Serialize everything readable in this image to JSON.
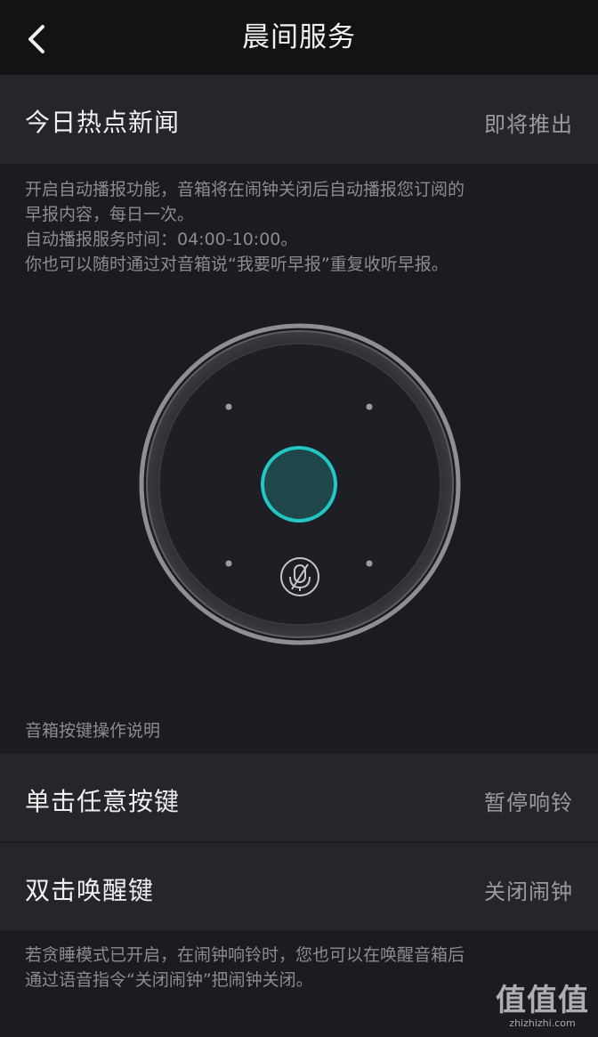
{
  "nav": {
    "title": "晨间服务",
    "back_icon": "chevron-left-icon"
  },
  "news_row": {
    "label": "今日热点新闻",
    "value": "即将推出"
  },
  "description": {
    "lines": [
      "开启自动播报功能，音箱将在闹钟关闭后自动播报您订阅的",
      "早报内容，每日一次。",
      "自动播报服务时间：04:00-10:00。",
      "你也可以随时通过对音箱说“我要听早报”重复收听早报。"
    ]
  },
  "speaker": {
    "accent_color": "#23c6c4",
    "icons": [
      "microphone-muted-icon"
    ]
  },
  "buttons_section": {
    "caption": "音箱按键操作说明",
    "rows": [
      {
        "label": "单击任意按键",
        "value": "暂停响铃"
      },
      {
        "label": "双击唤醒键",
        "value": "关闭闹钟"
      }
    ]
  },
  "footer_note": {
    "lines": [
      "若贪睡模式已开启，在闹钟响铃时，您也可以在唤醒音箱后",
      "通过语音指令“关闭闹钟”把闹钟关闭。"
    ]
  },
  "watermark": {
    "logo": "值值值",
    "url": "zhizhizhi.com"
  }
}
